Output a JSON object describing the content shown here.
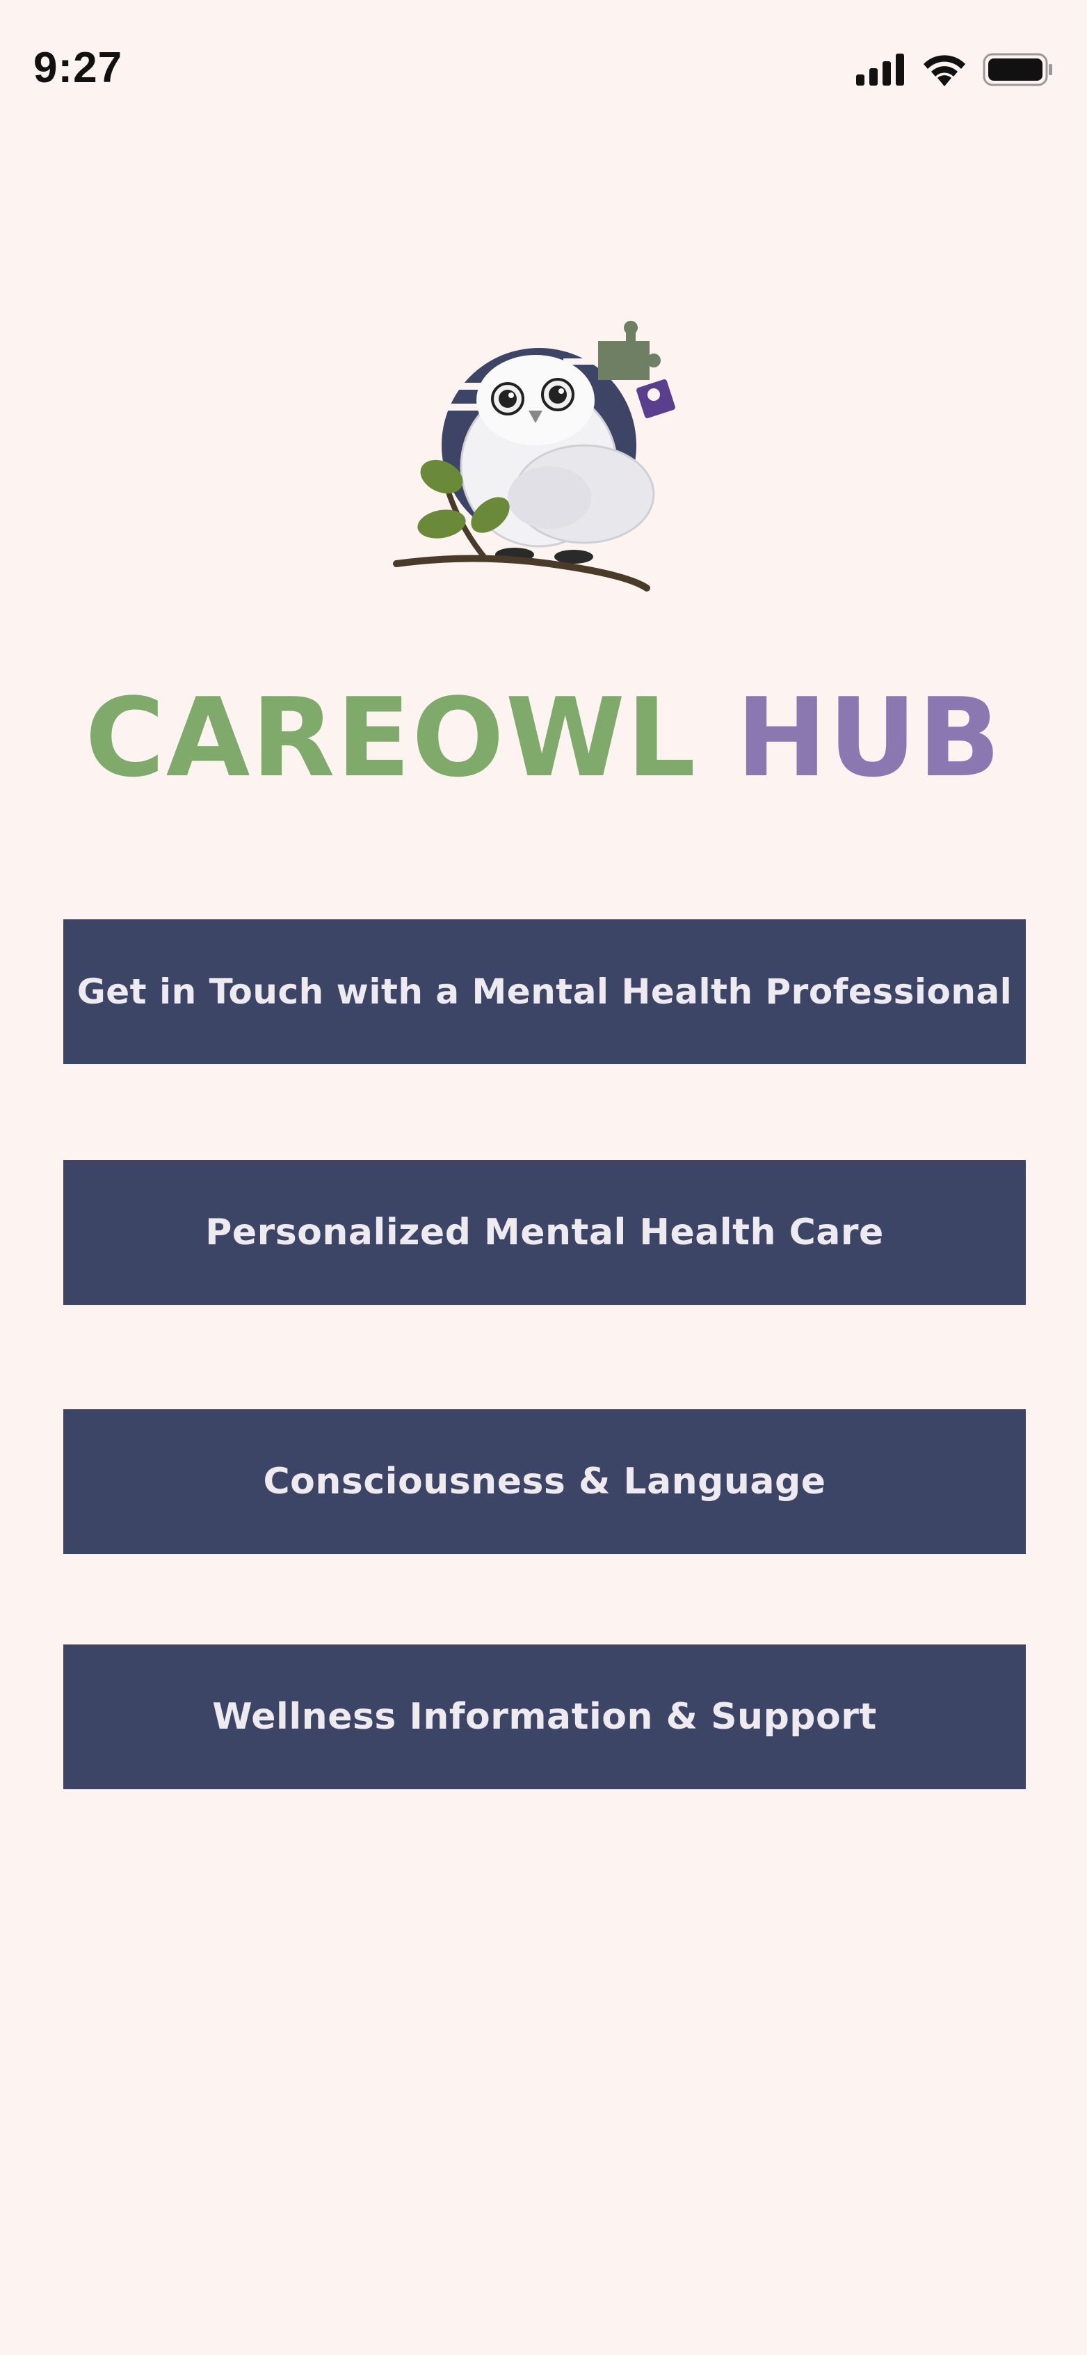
{
  "status_bar": {
    "time": "9:27",
    "icons": [
      "signal-icon",
      "wifi-icon",
      "battery-icon"
    ]
  },
  "logo": {
    "icon": "owl-logo-icon"
  },
  "title": {
    "part1": "CAREOWL",
    "part2": "HUB"
  },
  "menu": {
    "items": [
      {
        "label": "Get in Touch with a Mental Health Professional"
      },
      {
        "label": "Personalized Mental Health Care"
      },
      {
        "label": "Consciousness & Language"
      },
      {
        "label": "Wellness Information & Support"
      }
    ]
  },
  "colors": {
    "background": "#fdf4f2",
    "button": "#3c4565",
    "button_text": "#eeeaf0",
    "title_green": "#7faa6b",
    "title_purple": "#8c78b0"
  }
}
